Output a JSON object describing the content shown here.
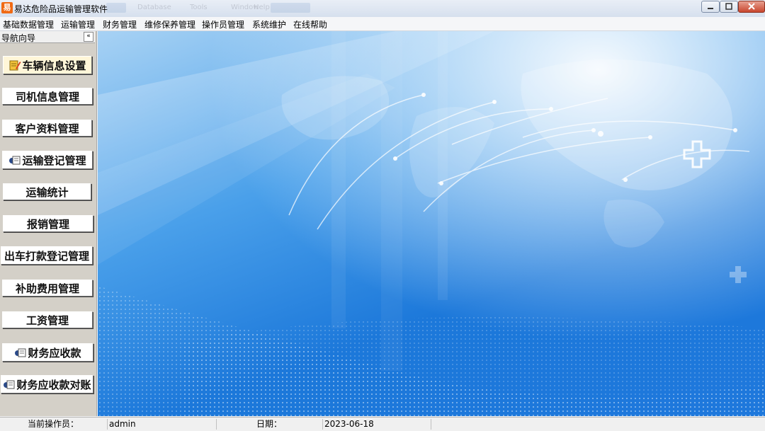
{
  "window": {
    "title": "易达危险品运输管理软件",
    "app_icon_text": "易",
    "ghost_menu": [
      "Database",
      "Tools",
      "Window",
      "Help"
    ]
  },
  "menu": [
    "基础数据管理",
    "运输管理",
    "财务管理",
    "维修保养管理",
    "操作员管理",
    "系统维护",
    "在线帮助"
  ],
  "nav": {
    "header": "导航向导",
    "collapse": "«",
    "buttons": [
      {
        "label": "车辆信息设置",
        "icon": "notepad-pencil-icon"
      },
      {
        "label": "司机信息管理",
        "icon": ""
      },
      {
        "label": "客户资料管理",
        "icon": ""
      },
      {
        "label": "运输登记管理",
        "icon": "form-icon"
      },
      {
        "label": "运输统计",
        "icon": ""
      },
      {
        "label": "报销管理",
        "icon": ""
      },
      {
        "label": "出车打款登记管理",
        "icon": ""
      },
      {
        "label": "补助费用管理",
        "icon": ""
      },
      {
        "label": "工资管理",
        "icon": ""
      },
      {
        "label": "财务应收款",
        "icon": "form-icon"
      },
      {
        "label": "财务应收款对账",
        "icon": "form-icon"
      }
    ]
  },
  "status": {
    "operator_label": "当前操作员：",
    "operator_value": "admin",
    "date_label": "日期：",
    "date_value": "2023-06-18"
  },
  "colors": {
    "accent": "#1e78dc",
    "app_icon": "#f06a14",
    "close_button": "#c8462e"
  }
}
